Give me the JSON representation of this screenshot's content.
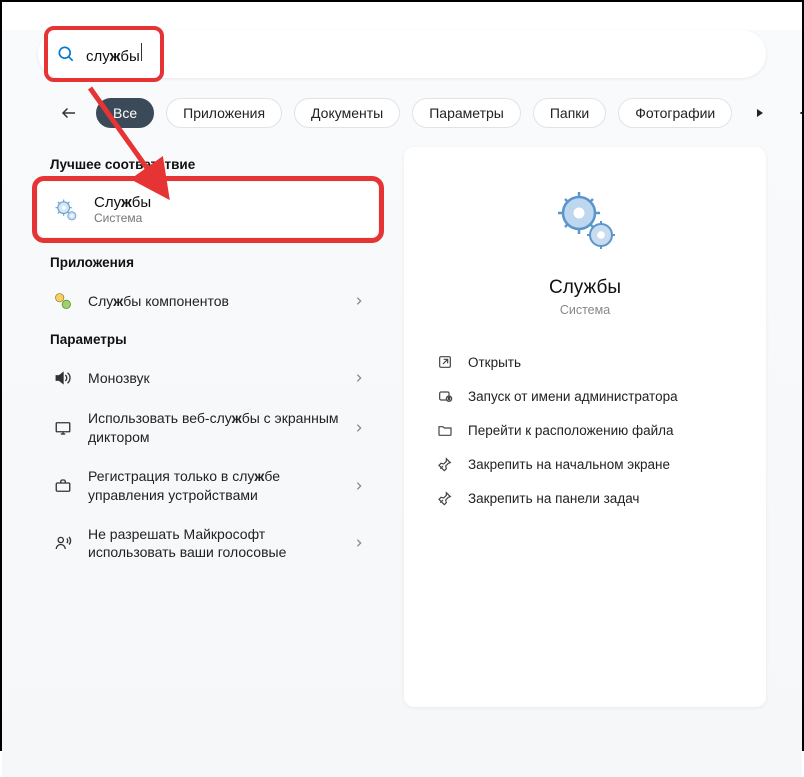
{
  "search": {
    "prefix": "слу",
    "bold": "ж",
    "suffix": "бы"
  },
  "filters": {
    "all": "Все",
    "apps": "Приложения",
    "docs": "Документы",
    "params": "Параметры",
    "folders": "Папки",
    "photos": "Фотографии"
  },
  "sections": {
    "best_match": "Лучшее соответствие",
    "apps": "Приложения",
    "params": "Параметры"
  },
  "best": {
    "title_prefix": "Слу",
    "title_bold": "ж",
    "title_suffix": "бы",
    "subtitle": "Система"
  },
  "apps_list": [
    {
      "label_pre": "Слу",
      "label_bold": "ж",
      "label_post": "бы компонентов"
    }
  ],
  "params_list": [
    {
      "text": "Монозвук"
    },
    {
      "text_pre": "Использовать веб-слу",
      "text_bold": "ж",
      "text_post": "бы с экранным диктором"
    },
    {
      "text_pre": "Регистрация только в слу",
      "text_bold": "ж",
      "text_post": "бе управления устройствами"
    },
    {
      "text": "Не разрешать Майкрософт использовать ваши голосовые"
    }
  ],
  "preview": {
    "title": "Службы",
    "subtitle": "Система"
  },
  "actions": {
    "open": "Открыть",
    "run_admin": "Запуск от имени администратора",
    "open_location": "Перейти к расположению файла",
    "pin_start": "Закрепить на начальном экране",
    "pin_taskbar": "Закрепить на панели задач"
  }
}
